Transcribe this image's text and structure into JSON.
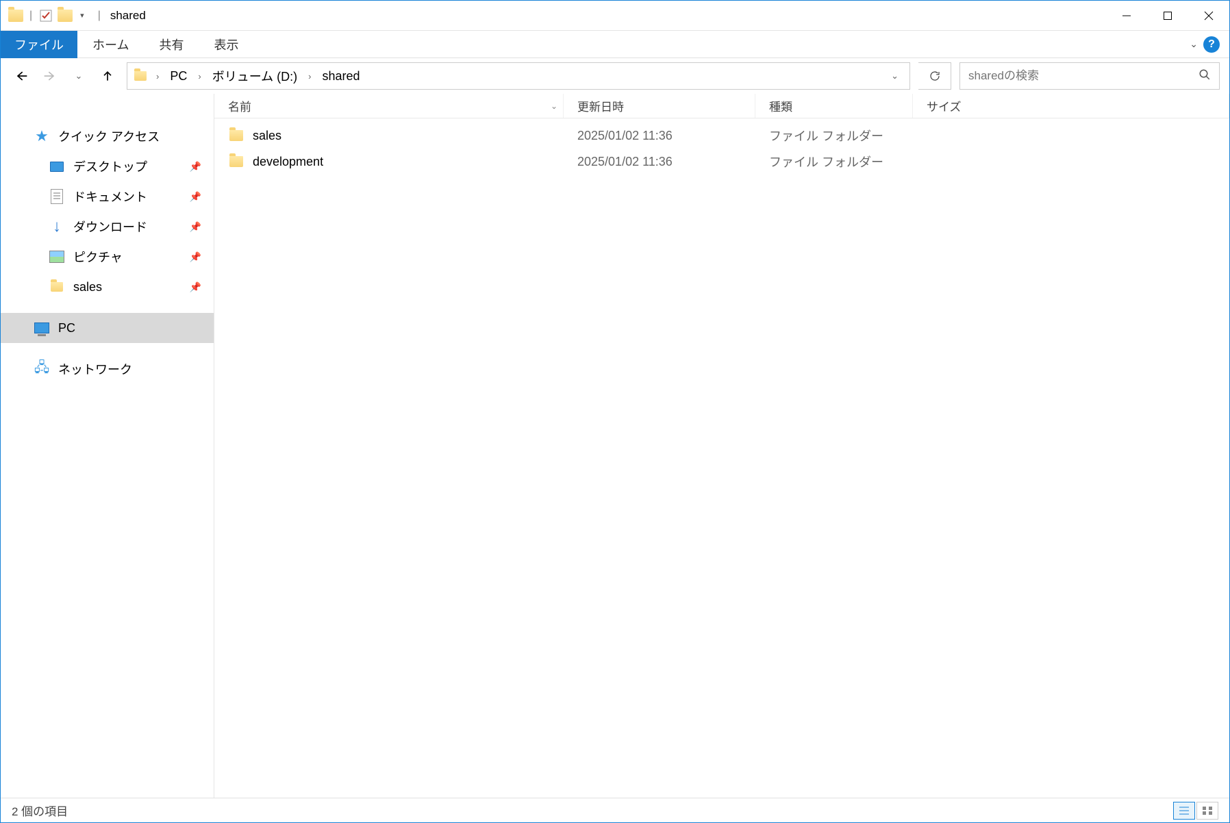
{
  "title": "shared",
  "ribbon": {
    "file": "ファイル",
    "home": "ホーム",
    "share": "共有",
    "view": "表示"
  },
  "breadcrumb": {
    "seg1": "PC",
    "seg2": "ボリューム (D:)",
    "seg3": "shared"
  },
  "search": {
    "placeholder": "sharedの検索"
  },
  "sidebar": {
    "quick_access": "クイック アクセス",
    "desktop": "デスクトップ",
    "documents": "ドキュメント",
    "downloads": "ダウンロード",
    "pictures": "ピクチャ",
    "sales": "sales",
    "pc": "PC",
    "network": "ネットワーク"
  },
  "columns": {
    "name": "名前",
    "date": "更新日時",
    "type": "種類",
    "size": "サイズ"
  },
  "files": [
    {
      "name": "sales",
      "date": "2025/01/02 11:36",
      "type": "ファイル フォルダー"
    },
    {
      "name": "development",
      "date": "2025/01/02 11:36",
      "type": "ファイル フォルダー"
    }
  ],
  "status": "2 個の項目"
}
